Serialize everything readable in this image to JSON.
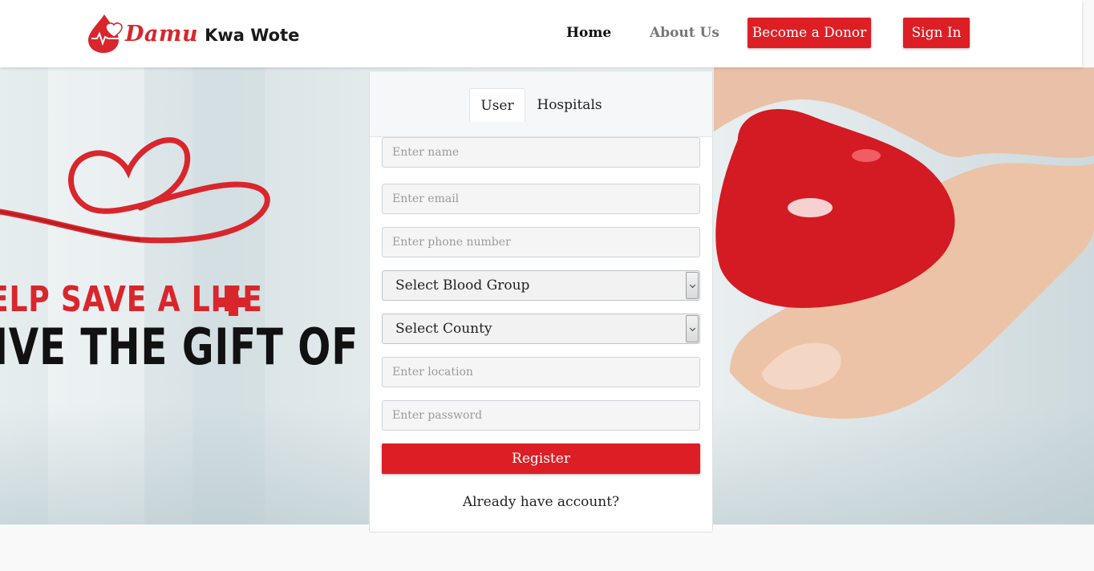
{
  "header": {
    "logo": {
      "word1": "Damu",
      "word2": "Kwa Wote"
    },
    "nav": {
      "home": "Home",
      "about": "About Us"
    },
    "buttons": {
      "donor": "Become a Donor",
      "signin": "Sign In"
    }
  },
  "hero": {
    "slogan_line1": "ELP SAVE A LIFE",
    "slogan_line2": "IVE THE GIFT OF BLO"
  },
  "form": {
    "tabs": [
      "User",
      "Hospitals"
    ],
    "active_tab": "User",
    "placeholders": {
      "name": "Enter name",
      "email": "Enter email",
      "phone": "Enter phone number",
      "location": "Enter location",
      "password": "Enter password"
    },
    "selects": {
      "blood_group": "Select Blood Group",
      "county": "Select County"
    },
    "register_label": "Register",
    "already_text": "Already have account?"
  },
  "colors": {
    "brand_red": "#dd1f25",
    "header_bg": "#ffffff",
    "card_header_bg": "#f6f7f8"
  }
}
